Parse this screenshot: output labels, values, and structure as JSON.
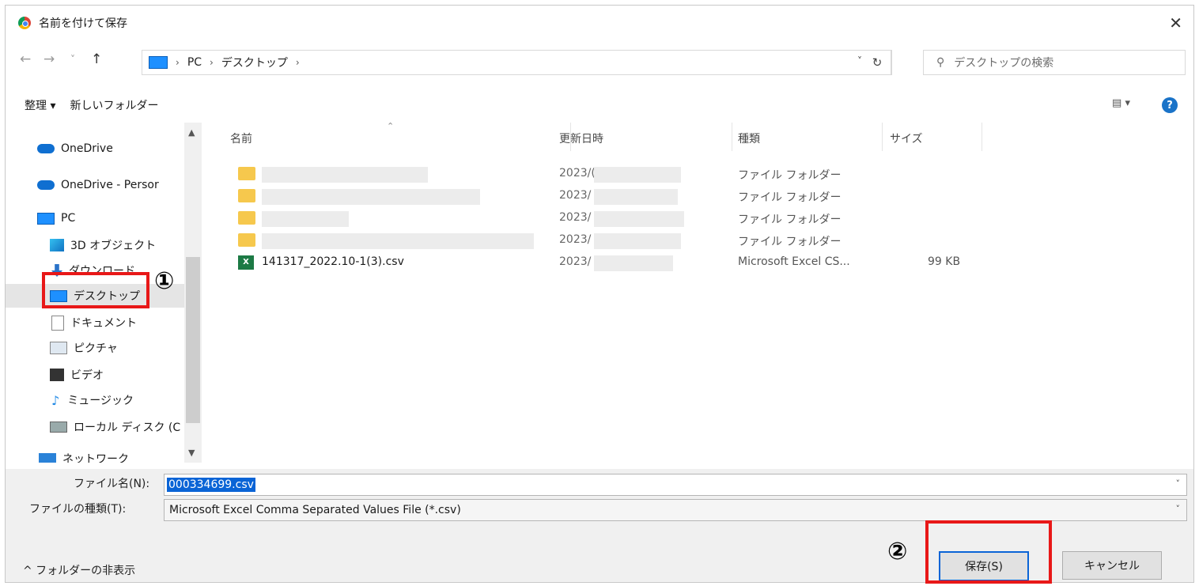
{
  "window": {
    "title": "名前を付けて保存",
    "close": "✕"
  },
  "nav": {
    "back": "←",
    "forward": "→",
    "recent": "˅",
    "up": "↑",
    "breadcrumb": [
      "PC",
      "デスクトップ"
    ],
    "separator": "›",
    "dropdown": "˅",
    "refresh": "↻",
    "search_placeholder": "デスクトップの検索"
  },
  "toolbar": {
    "organize": "整理 ▾",
    "new_folder": "新しいフォルダー",
    "view": "▤ ▾",
    "help": "?"
  },
  "sidebar": {
    "items": [
      {
        "label": "OneDrive",
        "icon": "cloud-icon"
      },
      {
        "label": "OneDrive - Persor",
        "icon": "cloud-icon"
      },
      {
        "label": "PC",
        "icon": "pc-icon"
      },
      {
        "label": "3D オブジェクト",
        "icon": "cube-icon"
      },
      {
        "label": "ダウンロード",
        "icon": "download-icon"
      },
      {
        "label": "デスクトップ",
        "icon": "desktop-icon",
        "selected": true
      },
      {
        "label": "ドキュメント",
        "icon": "document-icon"
      },
      {
        "label": "ピクチャ",
        "icon": "picture-icon"
      },
      {
        "label": "ビデオ",
        "icon": "video-icon"
      },
      {
        "label": "ミュージック",
        "icon": "music-icon"
      },
      {
        "label": "ローカル ディスク (C",
        "icon": "disk-icon"
      },
      {
        "label": "ネットワーク",
        "icon": "network-icon"
      }
    ]
  },
  "columns": {
    "name": "名前",
    "modified": "更新日時",
    "type": "種類",
    "size": "サイズ"
  },
  "files": [
    {
      "name": "",
      "date": "2023/(",
      "type": "ファイル フォルダー",
      "size": ""
    },
    {
      "name": "",
      "date": "2023/",
      "type": "ファイル フォルダー",
      "size": ""
    },
    {
      "name": "",
      "date": "2023/",
      "type": "ファイル フォルダー",
      "size": ""
    },
    {
      "name": "",
      "date": "2023/",
      "type": "ファイル フォルダー",
      "size": ""
    },
    {
      "name": "141317_2022.10-1(3).csv",
      "date": "2023/",
      "type": "Microsoft Excel CS...",
      "size": "99 KB"
    }
  ],
  "form": {
    "filename_label": "ファイル名(N):",
    "filename_value": "000334699.csv",
    "filetype_label": "ファイルの種類(T):",
    "filetype_value": "Microsoft Excel Comma Separated Values File (*.csv)"
  },
  "footer": {
    "hide_folders": "^ フォルダーの非表示",
    "save": "保存(S)",
    "cancel": "キャンセル"
  },
  "annotations": {
    "marker1": "①",
    "marker2": "②"
  }
}
